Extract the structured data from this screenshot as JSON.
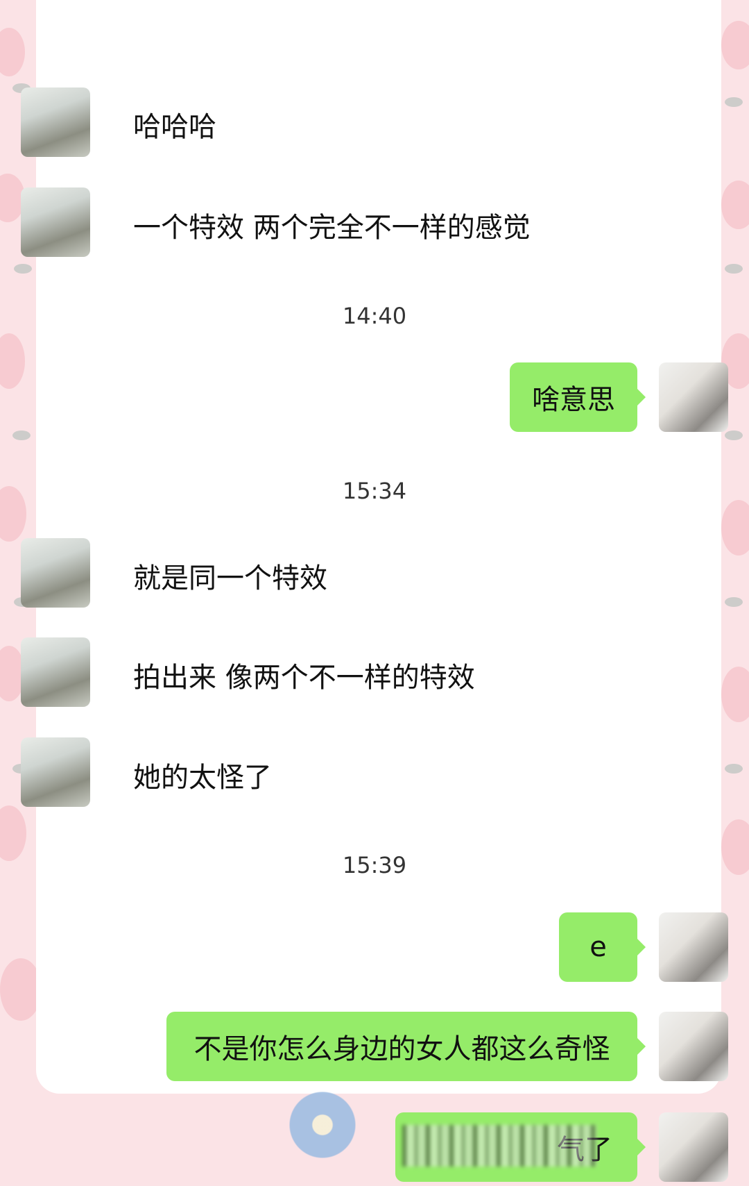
{
  "chat": {
    "messages": [
      {
        "sender": "other",
        "text": "哈哈哈"
      },
      {
        "sender": "other",
        "text": "一个特效 两个完全不一样的感觉"
      },
      {
        "time": "14:40"
      },
      {
        "sender": "self",
        "text": "啥意思"
      },
      {
        "time": "15:34"
      },
      {
        "sender": "other",
        "text": "就是同一个特效"
      },
      {
        "sender": "other",
        "text": "拍出来 像两个不一样的特效"
      },
      {
        "sender": "other",
        "text": "她的太怪了"
      },
      {
        "time": "15:39"
      },
      {
        "sender": "self",
        "text": "e"
      },
      {
        "sender": "self",
        "text": "不是你怎么身边的女人都这么奇怪"
      },
      {
        "sender": "self",
        "text": "气了"
      }
    ]
  },
  "colors": {
    "bubble_self": "#95ec69",
    "background": "#fbe3e6",
    "card": "#ffffff"
  },
  "icons": {
    "other_avatar": "masked-person-avatar",
    "self_avatar": "woman-portrait-avatar"
  }
}
